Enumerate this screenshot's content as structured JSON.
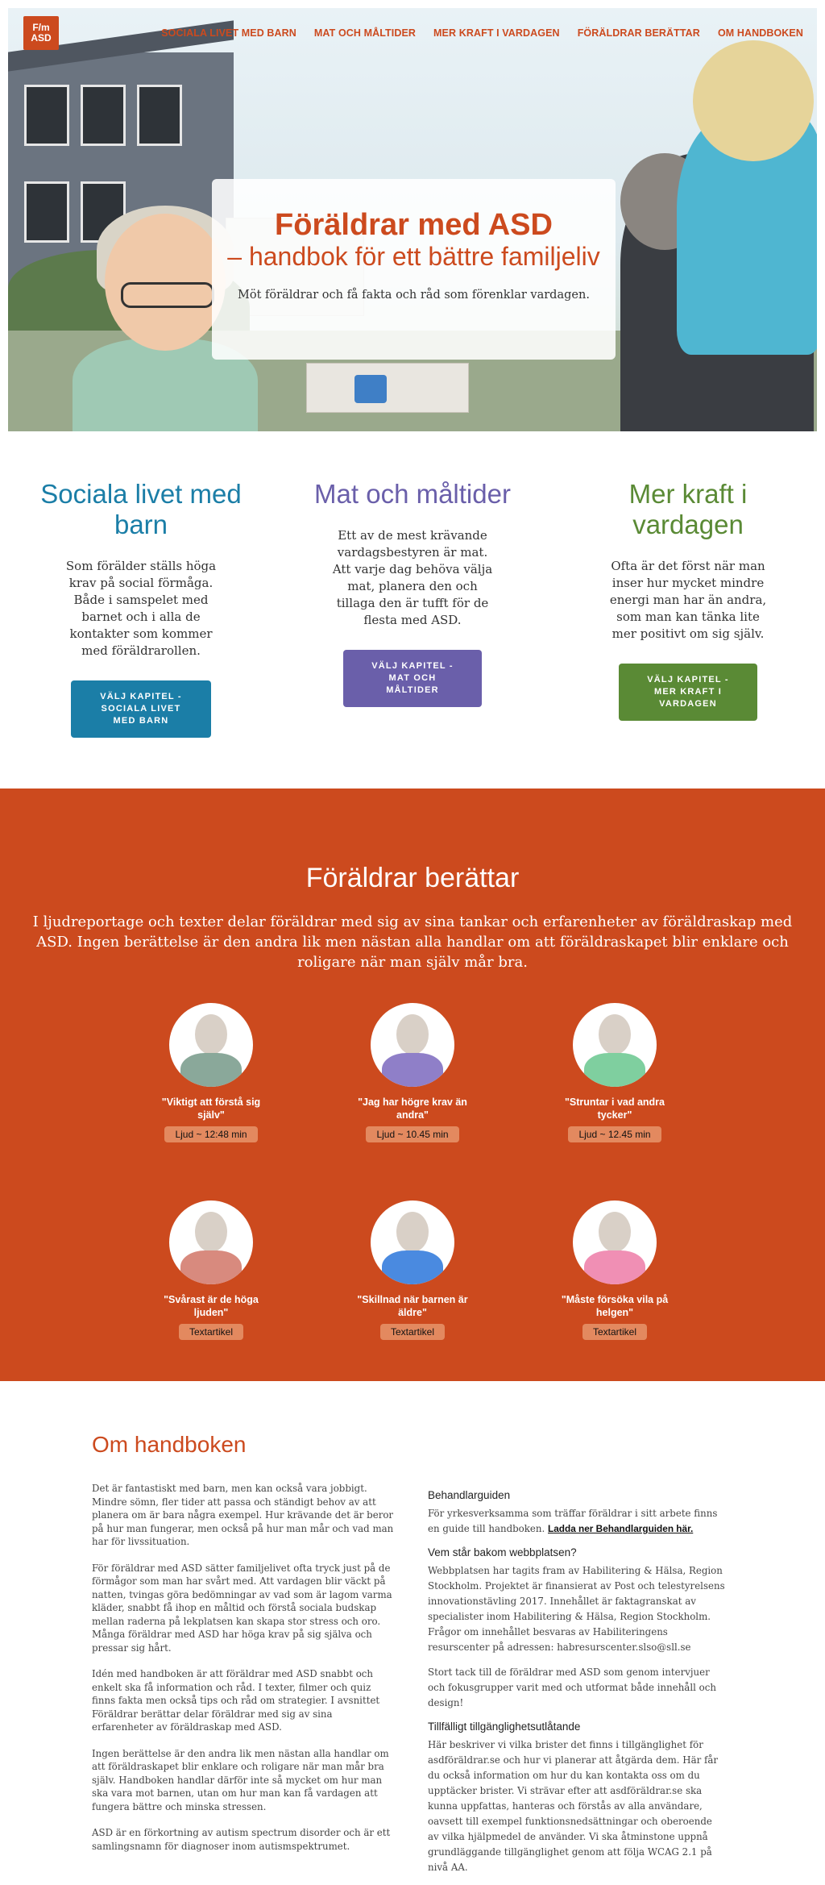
{
  "logo": {
    "line1": "F/m",
    "line2": "ASD"
  },
  "nav": {
    "items": [
      "SOCIALA LIVET MED BARN",
      "MAT OCH MÅLTIDER",
      "MER KRAFT I VARDAGEN",
      "FÖRÄLDRAR BERÄTTAR",
      "OM HANDBOKEN"
    ]
  },
  "hero": {
    "title": "Föräldrar med ASD",
    "subtitle": "– handbok för ett bättre familjeliv",
    "text": "Möt föräldrar och få fakta och råd som förenklar vardagen."
  },
  "columns": [
    {
      "title": "Sociala livet med barn",
      "text": "Som förälder ställs höga krav på social förmåga. Både i samspelet med barnet och i alla de kontakter som kommer med föräldrarollen.",
      "button": "VÄLJ KAPITEL - SOCIALA LIVET MED BARN",
      "color": "#1b7ea7"
    },
    {
      "title": "Mat och måltider",
      "text": "Ett av de mest krävande vardagsbestyren är mat. Att varje dag behöva välja mat, planera den och tillaga den är tufft för de flesta med ASD.",
      "button": "VÄLJ KAPITEL - MAT OCH MÅLTIDER",
      "color": "#6a5faa"
    },
    {
      "title": "Mer kraft i vardagen",
      "text": "Ofta är det först när man inser hur mycket mindre energi man har än andra, som man kan tänka lite mer positivt om sig själv.",
      "button": "VÄLJ KAPITEL - MER KRAFT I VARDAGEN",
      "color": "#5a8a35"
    }
  ],
  "stories": {
    "title": "Föräldrar berättar",
    "lead": "I ljudreportage och texter delar föräldrar med sig av sina tankar och erfarenheter av föräldraskap med ASD. Ingen berättelse är den andra lik men nästan alla handlar om att föräldraskapet blir enklare och roligare när man själv mår bra.",
    "cards": [
      {
        "quote": "\"Viktigt att förstå sig själv\"",
        "tag": "Ljud ~ 12:48 min",
        "shirt": "#8aa89a",
        "avatar": "man-avatar-icon"
      },
      {
        "quote": "\"Jag har högre krav än andra\"",
        "tag": "Ljud ~ 10.45 min",
        "shirt": "#8f7fc8",
        "avatar": "woman-avatar-icon"
      },
      {
        "quote": "\"Struntar i vad andra tycker\"",
        "tag": "Ljud ~ 12.45 min",
        "shirt": "#7fcf9f",
        "avatar": "woman-avatar-icon"
      },
      {
        "quote": "\"Svårast är de höga ljuden\"",
        "tag": "Textartikel",
        "shirt": "#d88a7e",
        "avatar": "woman-avatar-icon"
      },
      {
        "quote": "\"Skillnad när barnen är äldre\"",
        "tag": "Textartikel",
        "shirt": "#4a8ae0",
        "avatar": "man-avatar-icon"
      },
      {
        "quote": "\"Måste försöka vila på helgen\"",
        "tag": "Textartikel",
        "shirt": "#f08fb4",
        "avatar": "woman-avatar-icon"
      }
    ]
  },
  "about": {
    "title": "Om handboken",
    "left": [
      "Det är fantastiskt med barn, men kan också vara jobbigt. Mindre sömn, fler tider att passa och ständigt behov av att planera om är bara några exempel. Hur krävande det är beror på hur man fungerar, men också på hur man mår och vad man har för livssituation.",
      "För föräldrar med ASD sätter familjelivet ofta tryck just på de förmågor som man har svårt med. Att vardagen blir väckt på natten, tvingas göra bedömningar av vad som är lagom varma kläder, snabbt få ihop en måltid och förstå sociala budskap mellan raderna på lekplatsen kan skapa stor stress och oro. Många föräldrar med ASD har höga krav på sig själva och pressar sig hårt.",
      "Idén med handboken är att föräldrar med ASD snabbt och enkelt ska få information och råd. I texter, filmer och quiz finns fakta men också tips och råd om strategier. I avsnittet Föräldrar berättar delar föräldrar med sig av sina erfarenheter av föräldraskap med ASD.",
      "Ingen berättelse är den andra lik men nästan alla handlar om att föräldraskapet blir enklare och roligare när man mår bra själv. Handboken handlar därför inte så mycket om hur man ska vara mot barnen, utan om hur man kan få vardagen att fungera bättre och minska stressen.",
      "ASD är en förkortning av autism spectrum disorder och är ett samlingsnamn för diagnoser inom autismspektrumet."
    ],
    "guide_title": "Behandlarguiden",
    "guide_text": "För yrkesverksamma som träffar föräldrar i sitt arbete finns en guide till handboken.",
    "guide_link": "Ladda ner Behandlarguiden här.",
    "who_title": "Vem står bakom webbplatsen?",
    "who_text": "Webbplatsen har tagits fram av Habilitering & Hälsa, Region Stockholm. Projektet är finansierat av Post och telestyrelsens innovationstävling 2017. Innehållet är faktagranskat av specialister inom Habilitering & Hälsa, Region Stockholm. Frågor om innehållet besvaras av Habiliteringens resurscenter på adressen: habresurscenter.slso@sll.se",
    "thanks_text": "Stort tack till de föräldrar med ASD som genom intervjuer och fokusgrupper varit med och utformat både innehåll och design!",
    "access_title": "Tillfälligt tillgänglighetsutlåtande",
    "access_text": "Här beskriver vi vilka brister det finns i tillgänglighet för asdföräldrar.se och hur vi planerar att åtgärda dem. Här får du också information om hur du kan kontakta oss om du upptäcker brister. Vi strävar efter att asdföräldrar.se ska kunna uppfattas, hanteras och förstås av alla användare, oavsett till exempel funktionsnedsättningar och oberoende av vilka hjälpmedel de använder. Vi ska åtminstone uppnå grundläggande tillgänglighet genom att följa WCAG 2.1 på nivå AA."
  }
}
